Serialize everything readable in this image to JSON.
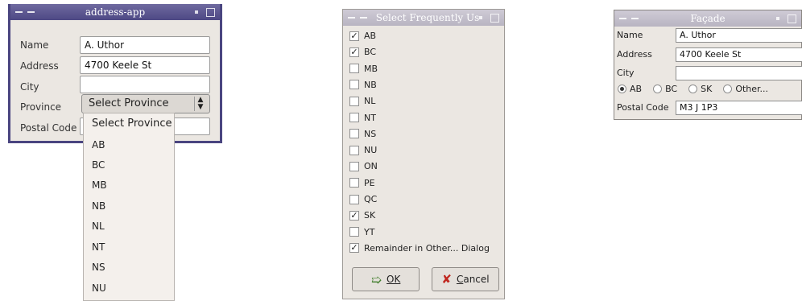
{
  "window1": {
    "title": "address-app",
    "labels": [
      "Name",
      "Address",
      "City",
      "Province",
      "Postal Code"
    ],
    "name_value": "A. Uthor",
    "address_value": "4700 Keele St",
    "city_value": "",
    "province_selected": "Select Province",
    "province_options": [
      "Select Province",
      "AB",
      "BC",
      "MB",
      "NB",
      "NL",
      "NT",
      "NS",
      "NU"
    ]
  },
  "window2": {
    "title": "Select Frequently Us",
    "items": [
      {
        "label": "AB",
        "checked": true
      },
      {
        "label": "BC",
        "checked": true
      },
      {
        "label": "MB",
        "checked": false
      },
      {
        "label": "NB",
        "checked": false
      },
      {
        "label": "NL",
        "checked": false
      },
      {
        "label": "NT",
        "checked": false
      },
      {
        "label": "NS",
        "checked": false
      },
      {
        "label": "NU",
        "checked": false
      },
      {
        "label": "ON",
        "checked": false
      },
      {
        "label": "PE",
        "checked": false
      },
      {
        "label": "QC",
        "checked": false
      },
      {
        "label": "SK",
        "checked": true
      },
      {
        "label": "YT",
        "checked": false
      },
      {
        "label": "Remainder in Other... Dialog",
        "checked": true
      }
    ],
    "ok_label": "OK",
    "cancel_label": "Cancel"
  },
  "window3": {
    "title": "Façade",
    "labels": [
      "Name",
      "Address",
      "City",
      "Postal Code"
    ],
    "name_value": "A. Uthor",
    "address_value": "4700 Keele St",
    "city_value": "",
    "radios": [
      {
        "label": "AB",
        "selected": true
      },
      {
        "label": "BC",
        "selected": false
      },
      {
        "label": "SK",
        "selected": false
      },
      {
        "label": "Other...",
        "selected": false
      }
    ],
    "postal_value": "M3 J 1P3"
  }
}
